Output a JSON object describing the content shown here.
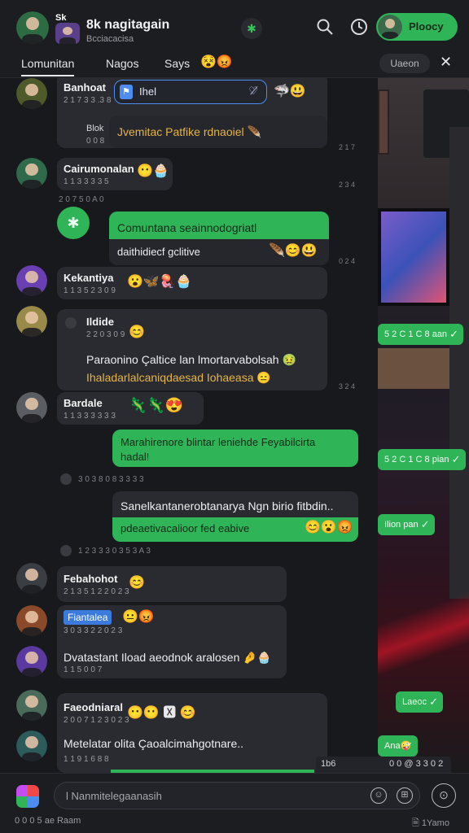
{
  "header": {
    "tag": "Sk",
    "title": "8k nagitagain",
    "subtitle": "Bcciacacisa",
    "search_icon": "search-icon",
    "history_icon": "clock-icon",
    "status_glyph": "✱",
    "button_label": "Ploocy"
  },
  "tabs": {
    "items": [
      "Lomunitan",
      "Nagos",
      "Says"
    ],
    "emoji": "😵😡",
    "right_label": "Uaeon",
    "close": "✕"
  },
  "colors": {
    "accent_green": "#2fb457",
    "bubble": "#2a2b30",
    "quote_blue": "#4d8cf0",
    "gold_text": "#e7b444"
  },
  "messages": {
    "m1": {
      "name": "Banhoat",
      "time": "2 1 7 3 3 .3 8",
      "quote_label": "Ihel",
      "quote_end": "♡̸",
      "reaction": "🦈😃",
      "label2": "Blok",
      "label3": "0 0 8",
      "text": "Jvemitac Patfike rdnaoiel 🪶",
      "side": "2 1 7"
    },
    "m2": {
      "name": "Cairumonalan",
      "emoji": "😶🧁",
      "time": "1 1 3 3 3 3 5"
    },
    "sys1": "2 0 7  5 0 A 0",
    "m3": {
      "text1": "Comuntana seainnodogriatl",
      "text2": "daithidiecf gclitive",
      "emoji": "🪶😊😃",
      "side": "0 2 4"
    },
    "m4": {
      "name": "Kekantiya",
      "emoji": "😮🦋🪼🧁",
      "time": "1 1 3 5 2 3 0 9"
    },
    "m5": {
      "name": "Ildide",
      "time": "2 2 0 3 0 9",
      "emoji_top": "😊",
      "text1": "Paraonino Çaltice lan lmortarvabolsah 🤢",
      "text2": "Ihaladarlalcaniqdaesad Iohaeasa 😑",
      "side": "3 2 4"
    },
    "m6": {
      "name": "Bardale",
      "emoji": "🦎🦎😍",
      "time": "1 1 3 3 3 3 3 3"
    },
    "m7": {
      "text1": "Marahirenore blintar leniehde Feyabilcirta",
      "text2": "hadal!"
    },
    "sys2": "3 0 3 8  0 8 3 3 3 3",
    "m8": {
      "text1": "Sanelkantanerobtanarya Ngn birio fitbdin..",
      "text2": "pdeaetivacalioor fed eabive",
      "emoji": "😊😮😡"
    },
    "sys3": "1 2 3 3  3 0 3  5 3 A 3",
    "m9": {
      "name": "Febahohot",
      "emoji": "😊",
      "time": "2 1 3 5 1 2 2 0 2 3"
    },
    "m10": {
      "tag": "Fiantalea",
      "emoji": "😐😡",
      "time": "3 0 3 3 2 2 0 2 3",
      "text": "Dvatastant Iload aeodnok aralosen 🤌🧁",
      "time2": "1 1 5  0 0 7"
    },
    "m11": {
      "name": "Faeodniaral",
      "emoji": "😶😶 🆇 😊",
      "time": "2 0 0 7 1 2 3 0 2 3",
      "text": "Metelatar olita Çaoalcimahgotnare..",
      "time2": "1 1 9 1 6 8 8"
    },
    "sent": [
      "5 2 C 1 C 8  aan",
      "5 2 C 1 C 8  pian",
      "Ilion  pan",
      "Laeoc",
      "Ana🤪"
    ]
  },
  "status_strip": {
    "left": "1b6",
    "right": "0 0 @ 3 3 0 2"
  },
  "composer": {
    "placeholder": "l Nanmitelegaanasih",
    "emoji_icon": "☺",
    "attach_icon": "⊞",
    "send_icon": "⊙"
  },
  "footer": {
    "left": "0 0 0 5 ae  Raam",
    "right": "🗎 1Yamo"
  }
}
